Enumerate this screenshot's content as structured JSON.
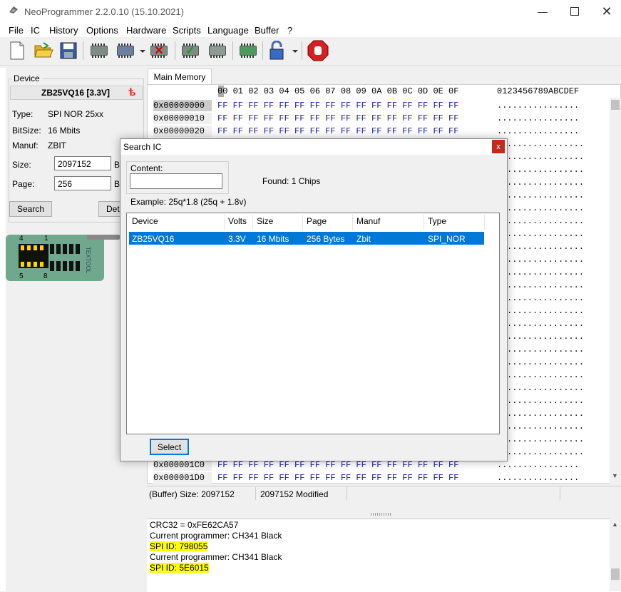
{
  "window": {
    "title": "NeoProgrammer 2.2.0.10 (15.10.2021)",
    "minimize_icon": "minimize-icon",
    "maximize_icon": "maximize-icon",
    "close_icon": "close-icon"
  },
  "menu": [
    "File",
    "IC",
    "History",
    "Options",
    "Hardware",
    "Scripts",
    "Language",
    "Buffer",
    "?"
  ],
  "toolbar": {
    "icons": [
      "new-file-icon",
      "open-folder-icon",
      "save-icon",
      "read-chip-icon",
      "write-chip-icon",
      "erase-chip-icon",
      "verify-chip-icon",
      "blank-check-icon",
      "auto-icon",
      "lock-icon",
      "stop-icon"
    ]
  },
  "device": {
    "group_label": "Device",
    "chip_name": "ZB25VQ16 [3.3V]",
    "type_label": "Type:",
    "type_value": "SPI NOR 25xx",
    "bitsize_label": "BitSize:",
    "bitsize_value": "16 Mbits",
    "manuf_label": "Manuf:",
    "manuf_value": "ZBIT",
    "size_label": "Size:",
    "size_value": "2097152",
    "size_unit": "B",
    "page_label": "Page:",
    "page_value": "256",
    "page_unit": "B",
    "search_button": "Search",
    "detect_button": "Det",
    "socket_pins": {
      "top_left": "4",
      "top_right": "1",
      "bottom_left": "5",
      "bottom_right": "8"
    },
    "socket_brand": "TEXTOOL"
  },
  "main": {
    "tab": "Main Memory",
    "hex_header": [
      "00",
      "01",
      "02",
      "03",
      "04",
      "05",
      "06",
      "07",
      "08",
      "09",
      "0A",
      "0B",
      "0C",
      "0D",
      "0E",
      "0F"
    ],
    "ascii_header": "0123456789ABCDEF",
    "rows": [
      {
        "addr": "0x00000000",
        "bytes": "FF FF FF FF FF FF FF FF FF FF FF FF FF FF FF FF",
        "ascii": "................"
      },
      {
        "addr": "0x00000010",
        "bytes": "FF FF FF FF FF FF FF FF FF FF FF FF FF FF FF FF",
        "ascii": "................"
      },
      {
        "addr": "0x00000020",
        "bytes": "FF FF FF FF FF FF FF FF FF FF FF FF FF FF FF FF",
        "ascii": "................"
      },
      {
        "addr": "0x000001C0",
        "bytes": "FF FF FF FF FF FF FF FF FF FF FF FF FF FF FF FF",
        "ascii": "................"
      },
      {
        "addr": "0x000001D0",
        "bytes": "FF FF FF FF FF FF FF FF FF FF FF FF FF FF FF FF",
        "ascii": "................"
      }
    ],
    "hidden_row_bytes": "FF",
    "hidden_row_ascii": "..............."
  },
  "status": {
    "buffer_size": "(Buffer) Size: 2097152",
    "modified": "2097152 Modified"
  },
  "log": [
    {
      "text": "CRC32 = 0xFE62CA57",
      "highlight": false
    },
    {
      "text": "Current programmer: CH341 Black",
      "highlight": false
    },
    {
      "text": "SPI ID: 798055",
      "highlight": true
    },
    {
      "text": "Current programmer: CH341 Black",
      "highlight": false
    },
    {
      "text": "SPI ID: 5E6015",
      "highlight": true
    }
  ],
  "dialog": {
    "title": "Search IC",
    "close_label": "x",
    "content_label": "Content:",
    "content_value": "",
    "found": "Found: 1  Chips",
    "example": "Example:  25q*1.8 (25q + 1.8v)",
    "columns": [
      "Device",
      "Volts",
      "Size",
      "Page",
      "Manuf",
      "Type"
    ],
    "results": [
      {
        "device": "ZB25VQ16",
        "volts": "3.3V",
        "size": "16 Mbits",
        "page": "256 Bytes",
        "manuf": "Zbit",
        "type": "SPI_NOR"
      }
    ],
    "select_button": "Select"
  },
  "colors": {
    "accent": "#0078d7",
    "hex_blue": "#1a1aa6",
    "highlight": "#ffff00",
    "close_red": "#c42b1c"
  }
}
